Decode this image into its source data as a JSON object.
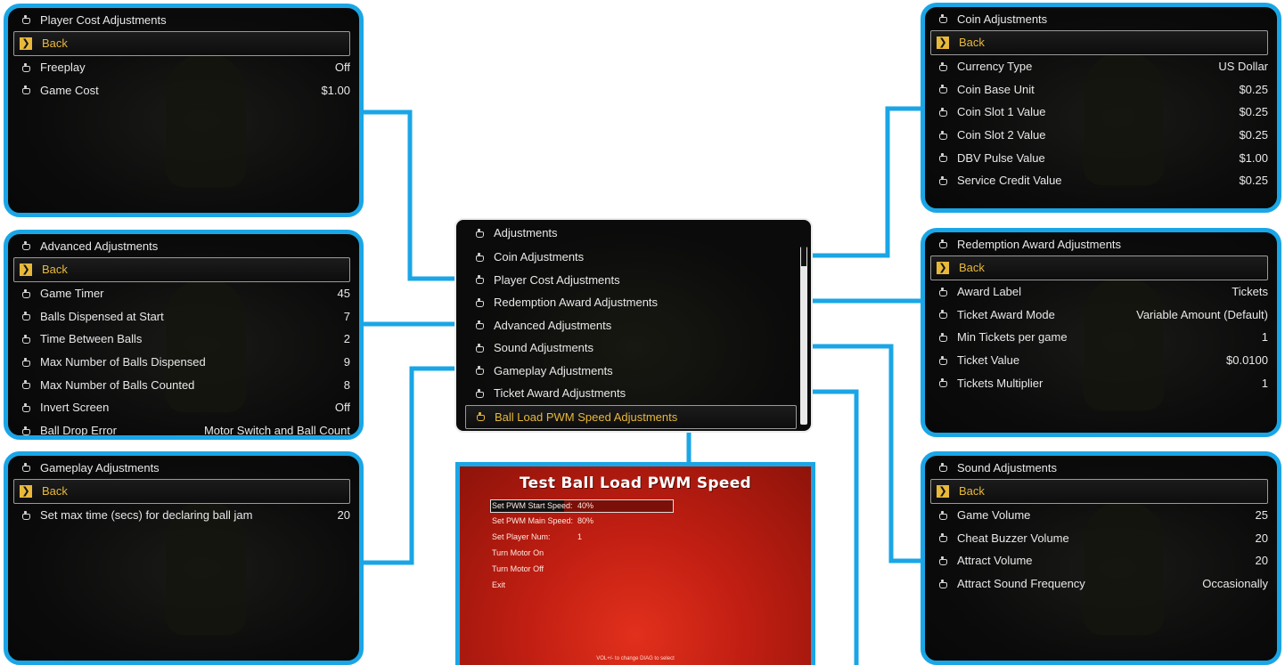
{
  "colors": {
    "accent": "#1aa6e6",
    "highlight": "#e8b83a",
    "test_panel_red": "#d42a18"
  },
  "icons": {
    "menu_item": "trophy-gear-icon",
    "back": "running-man-icon"
  },
  "center_menu": {
    "title": "Adjustments",
    "items": [
      "Coin Adjustments",
      "Player Cost Adjustments",
      "Redemption Award Adjustments",
      "Advanced Adjustments",
      "Sound Adjustments",
      "Gameplay Adjustments",
      "Ticket Award Adjustments",
      "Ball Load PWM Speed Adjustments"
    ],
    "selected_index": 7
  },
  "player_cost": {
    "title": "Player Cost Adjustments",
    "back": "Back",
    "rows": [
      {
        "label": "Freeplay",
        "value": "Off"
      },
      {
        "label": "Game Cost",
        "value": "$1.00"
      }
    ]
  },
  "advanced": {
    "title": "Advanced Adjustments",
    "back": "Back",
    "rows": [
      {
        "label": "Game Timer",
        "value": "45"
      },
      {
        "label": "Balls Dispensed at Start",
        "value": "7"
      },
      {
        "label": "Time Between Balls",
        "value": "2"
      },
      {
        "label": "Max Number of Balls Dispensed",
        "value": "9"
      },
      {
        "label": "Max Number of Balls Counted",
        "value": "8"
      },
      {
        "label": "Invert Screen",
        "value": "Off"
      },
      {
        "label": "Ball Drop Error",
        "value": "Motor Switch and Ball Count"
      }
    ]
  },
  "gameplay": {
    "title": "Gameplay Adjustments",
    "back": "Back",
    "rows": [
      {
        "label": "Set max time (secs) for declaring ball jam",
        "value": "20"
      }
    ]
  },
  "coin": {
    "title": "Coin Adjustments",
    "back": "Back",
    "rows": [
      {
        "label": "Currency Type",
        "value": "US Dollar"
      },
      {
        "label": "Coin Base Unit",
        "value": "$0.25"
      },
      {
        "label": "Coin Slot 1 Value",
        "value": "$0.25"
      },
      {
        "label": "Coin Slot 2 Value",
        "value": "$0.25"
      },
      {
        "label": "DBV Pulse Value",
        "value": "$1.00"
      },
      {
        "label": "Service Credit Value",
        "value": "$0.25"
      }
    ]
  },
  "redemption": {
    "title": "Redemption Award Adjustments",
    "back": "Back",
    "rows": [
      {
        "label": "Award Label",
        "value": "Tickets"
      },
      {
        "label": "Ticket Award Mode",
        "value": "Variable Amount (Default)"
      },
      {
        "label": "Min Tickets per game",
        "value": "1"
      },
      {
        "label": "Ticket Value",
        "value": "$0.0100"
      },
      {
        "label": "Tickets Multiplier",
        "value": "1"
      }
    ]
  },
  "sound": {
    "title": "Sound Adjustments",
    "back": "Back",
    "rows": [
      {
        "label": "Game Volume",
        "value": "25"
      },
      {
        "label": "Cheat Buzzer Volume",
        "value": "20"
      },
      {
        "label": "Attract Volume",
        "value": "20"
      },
      {
        "label": "Attract Sound Frequency",
        "value": "Occasionally"
      }
    ]
  },
  "test_pwm": {
    "title": "Test Ball Load PWM Speed",
    "rows": [
      {
        "label": "Set PWM Start Speed:",
        "value": "40%"
      },
      {
        "label": "Set PWM Main Speed:",
        "value": "80%"
      },
      {
        "label": "Set Player Num:",
        "value": "1"
      },
      {
        "label": "Turn Motor On",
        "value": ""
      },
      {
        "label": "Turn Motor Off",
        "value": ""
      },
      {
        "label": "Exit",
        "value": ""
      }
    ],
    "start_speed_fraction": 0.4,
    "footer": "VOL+/- to change DIAG to select"
  }
}
